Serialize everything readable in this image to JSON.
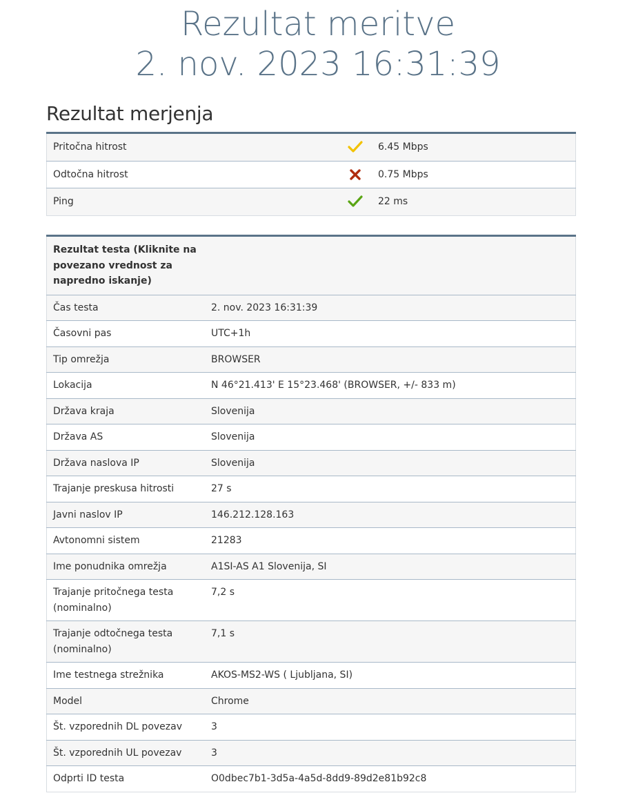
{
  "header": {
    "title": "Rezultat meritve",
    "datetime": "2. nov. 2023 16:31:39"
  },
  "summary": {
    "title": "Rezultat merjenja",
    "rows": [
      {
        "label": "Pritočna hitrost",
        "value": "6.45 Mbps",
        "status": "ok-yellow",
        "icon": "check-icon",
        "color": "#f2c200"
      },
      {
        "label": "Odtočna hitrost",
        "value": "0.75 Mbps",
        "status": "bad",
        "icon": "cross-icon",
        "color": "#b02c0e"
      },
      {
        "label": "Ping",
        "value": "22 ms",
        "status": "good",
        "icon": "check-icon",
        "color": "#5aa514"
      }
    ]
  },
  "details": {
    "header": "Rezultat testa (Kliknite na povezano vrednost za napredno iskanje)",
    "rows": [
      {
        "key": "Čas testa",
        "value": "2. nov. 2023 16:31:39"
      },
      {
        "key": "Časovni pas",
        "value": "UTC+1h"
      },
      {
        "key": "Tip omrežja",
        "value": "BROWSER"
      },
      {
        "key": "Lokacija",
        "value": "N 46°21.413' E 15°23.468' (BROWSER, +/- 833 m)"
      },
      {
        "key": "Država kraja",
        "value": "Slovenija"
      },
      {
        "key": "Država AS",
        "value": "Slovenija"
      },
      {
        "key": "Država naslova IP",
        "value": "Slovenija"
      },
      {
        "key": "Trajanje preskusa hitrosti",
        "value": "27 s"
      },
      {
        "key": "Javni naslov IP",
        "value": "146.212.128.163"
      },
      {
        "key": "Avtonomni sistem",
        "value": "21283"
      },
      {
        "key": "Ime ponudnika omrežja",
        "value": "A1SI-AS A1 Slovenija, SI"
      },
      {
        "key": "Trajanje pritočnega testa (nominalno)",
        "value": "7,2 s"
      },
      {
        "key": "Trajanje odtočnega testa (nominalno)",
        "value": "7,1 s"
      },
      {
        "key": "Ime testnega strežnika",
        "value": "AKOS-MS2-WS ( Ljubljana, SI)"
      },
      {
        "key": "Model",
        "value": "Chrome"
      },
      {
        "key": "Št. vzporednih DL povezav",
        "value": "3"
      },
      {
        "key": "Št. vzporednih UL povezav",
        "value": "3"
      },
      {
        "key": "Odprti ID testa",
        "value": "O0dbec7b1-3d5a-4a5d-8dd9-89d2e81b92c8"
      }
    ]
  }
}
